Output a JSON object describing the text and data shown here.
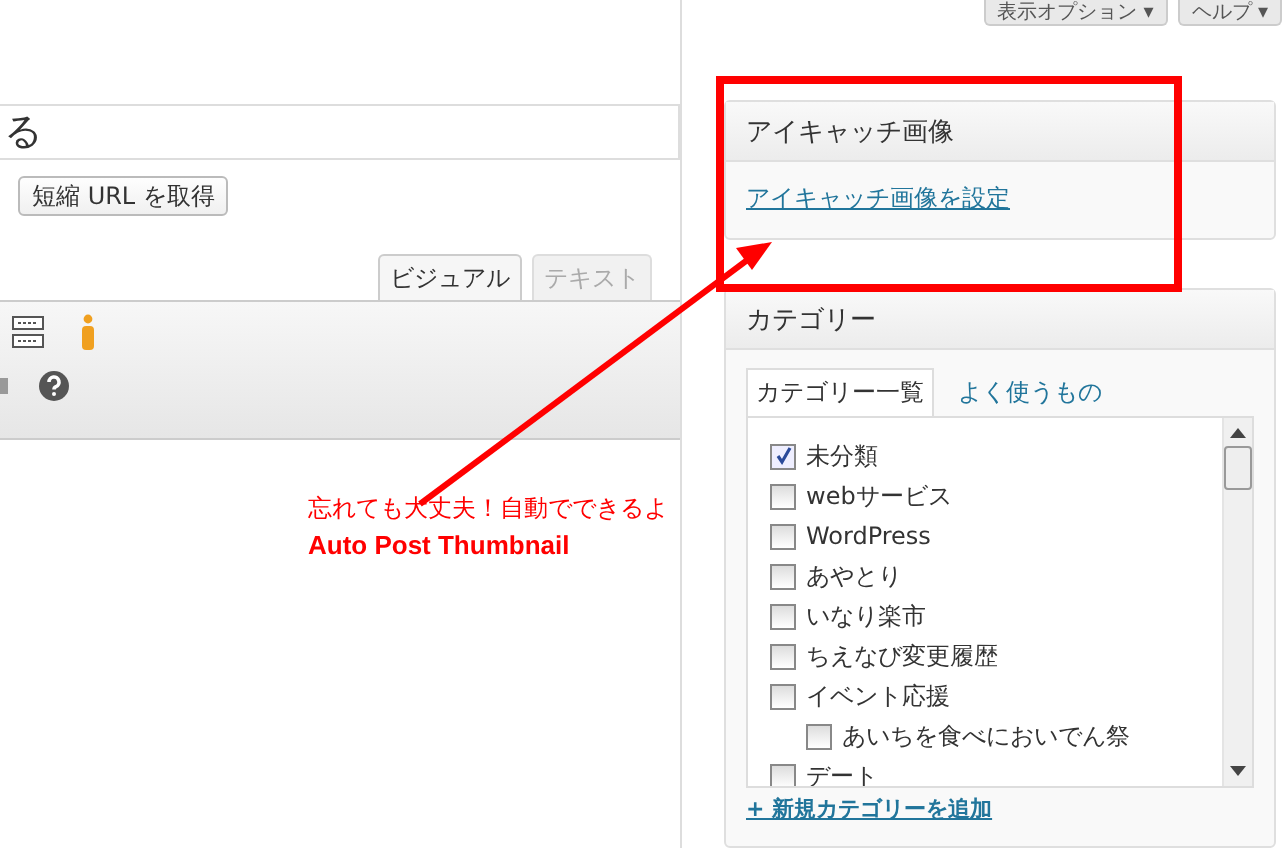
{
  "top_buttons": [
    {
      "label": "表示オプション ▾"
    },
    {
      "label": "ヘルプ ▾"
    }
  ],
  "title_field": {
    "value": "る"
  },
  "shortlink_button": "短縮 URL を取得",
  "editor_tabs": [
    {
      "label": "ビジュアル",
      "selected": true
    },
    {
      "label": "テキスト",
      "selected": false
    }
  ],
  "featured_image": {
    "title": "アイキャッチ画像",
    "link": "アイキャッチ画像を設定"
  },
  "categories": {
    "title": "カテゴリー",
    "tabs": [
      {
        "label": "カテゴリー一覧",
        "selected": true
      },
      {
        "label": "よく使うもの",
        "selected": false
      }
    ],
    "items": [
      {
        "label": "未分類",
        "checked": true
      },
      {
        "label": "webサービス",
        "checked": false
      },
      {
        "label": "WordPress",
        "checked": false
      },
      {
        "label": "あやとり",
        "checked": false
      },
      {
        "label": "いなり楽市",
        "checked": false
      },
      {
        "label": "ちえなび変更履歴",
        "checked": false
      },
      {
        "label": "イベント応援",
        "checked": false,
        "children": [
          {
            "label": "あいちを食べにおいでん祭",
            "checked": false
          }
        ]
      },
      {
        "label": "デート",
        "checked": false
      }
    ],
    "add_link": "+ 新規カテゴリーを追加"
  },
  "annotation": {
    "lines": [
      "忘れても大丈夫！自動でできるよ",
      "Auto Post Thumbnail"
    ]
  }
}
